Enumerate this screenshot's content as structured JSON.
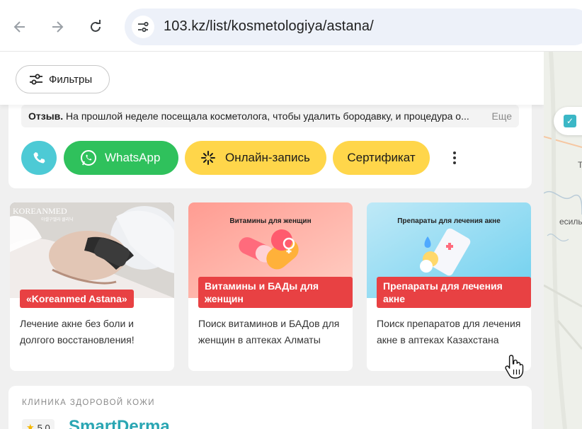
{
  "browser": {
    "url": "103.kz/list/kosmetologiya/astana/"
  },
  "filters": {
    "label": "Фильтры"
  },
  "review": {
    "prefix": "Отзыв.",
    "text": " На прошлой неделе посещала косметолога, чтобы удалить бородавку, и процедура о...",
    "more": "Еще"
  },
  "actions": {
    "whatsapp": "WhatsApp",
    "online": "Онлайн-запись",
    "certificate": "Сертификат"
  },
  "promos": [
    {
      "badge": "«Koreanmed Astana»",
      "text": "Лечение акне без боли и долгого восстановления!",
      "img_logo": "KOREANMED"
    },
    {
      "badge": "Витамины и БАДы для женщин",
      "text": "Поиск витаминов и БАДов для женщин в аптеках Алматы",
      "img_title": "Витамины для женщин"
    },
    {
      "badge": "Препараты для лечения акне",
      "text": "Поиск препаратов для лечения акне в аптеках Казахстана",
      "img_title": "Препараты для лечения акне"
    }
  ],
  "clinic": {
    "category": "КЛИНИКА ЗДОРОВОЙ КОЖИ",
    "rating": "5.0",
    "name": "SmartDerma"
  },
  "map": {
    "label1": "Т",
    "label2": "есиль"
  },
  "colors": {
    "accent": "#2aa6b3",
    "whatsapp": "#2fc15c",
    "yellow": "#ffd64a",
    "badge": "#e84143",
    "call": "#4dcad5"
  }
}
